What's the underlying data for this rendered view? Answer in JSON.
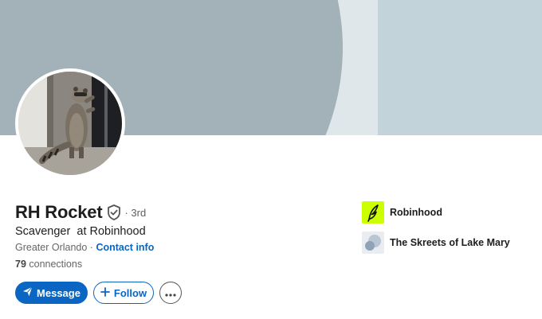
{
  "profile": {
    "name": "RH Rocket",
    "degree": "· 3rd",
    "headline": "Scavenger  at Robinhood",
    "location": "Greater Orlando",
    "location_separator": " · ",
    "contact_info_label": "Contact info",
    "connections_count": "79",
    "connections_label": " connections"
  },
  "actions": {
    "message_label": "Message",
    "follow_label": "Follow",
    "more_icon": "more-horizontal-icon"
  },
  "organizations": [
    {
      "name": "Robinhood",
      "logo_color": "#ccff00"
    },
    {
      "name": "The Skreets of Lake Mary",
      "logo_color": "#d0d9e2"
    }
  ],
  "colors": {
    "accent": "#0a66c2",
    "banner_light": "#c3d3da",
    "banner_mid": "#dfe7eb",
    "banner_dark": "#a2b2b8"
  }
}
